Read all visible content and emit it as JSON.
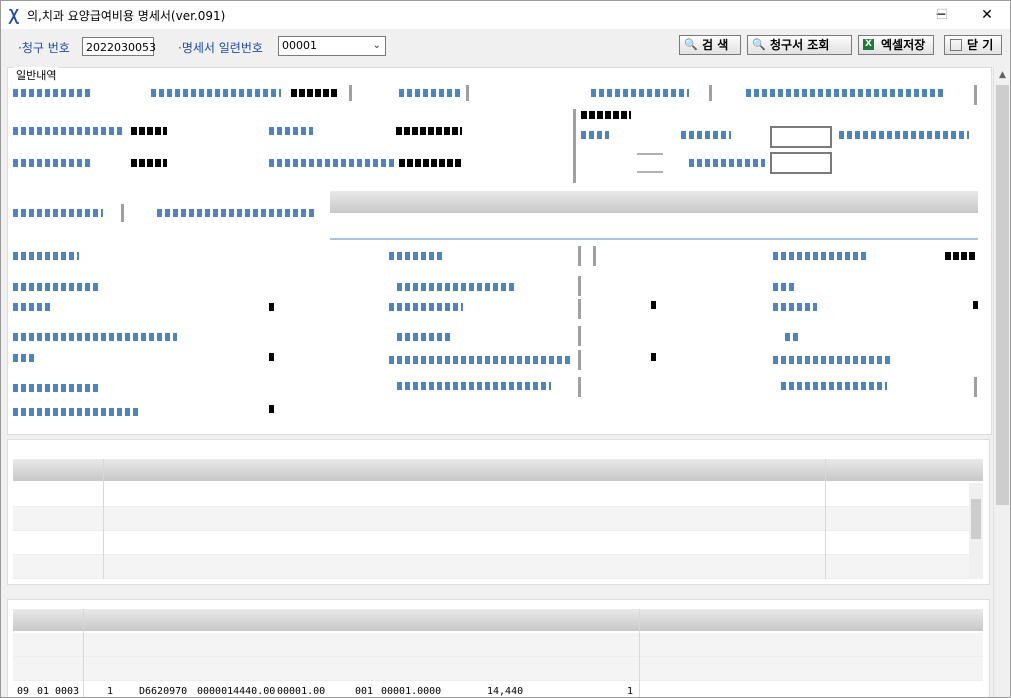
{
  "window": {
    "title": "의,치과 요양급여비용 명세서(ver.091)",
    "minimize": "─",
    "maximize": "☐",
    "close": "✕"
  },
  "toolbar": {
    "claim_no_label": "·청구 번호",
    "claim_no_value": "2022030053",
    "serial_label": "·명세서 일련번호",
    "serial_value": "00001",
    "search_label": "검 색",
    "claim_view_label": "청구서 조회",
    "excel_save_label": "엑셀저장",
    "close_label": "닫 기"
  },
  "sections": {
    "general": "일반내역"
  },
  "bottom_row": {
    "c1": "09",
    "c2": "01",
    "c3": "0003",
    "c4": "1",
    "c5": "D6620970",
    "c6": "0000014440.00",
    "c7": "00001.00",
    "c8": "001",
    "c9": "00001.0000",
    "c10": "14,440",
    "c11": "1"
  }
}
